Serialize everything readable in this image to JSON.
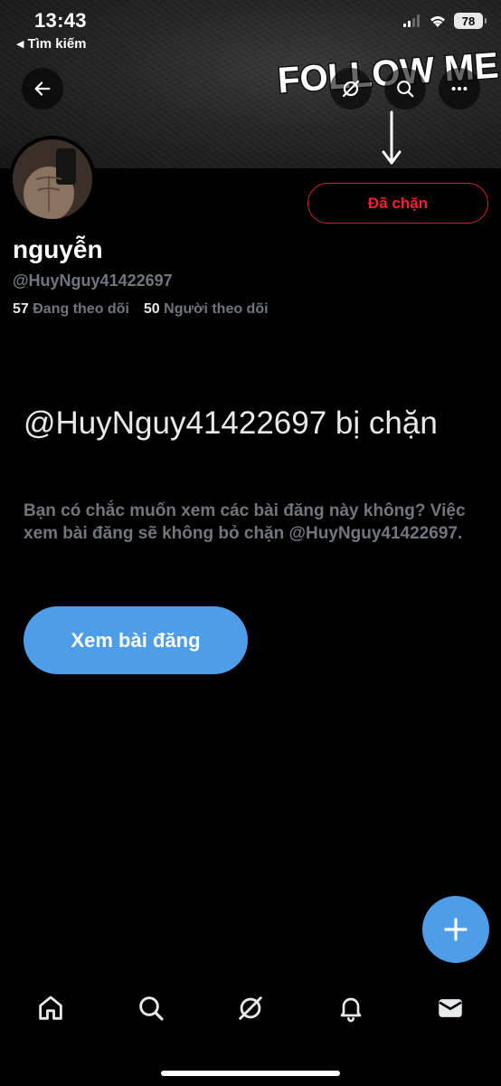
{
  "status_bar": {
    "time": "13:43",
    "back_app": "Tìm kiếm",
    "battery": "78"
  },
  "banner": {
    "text": "FOLLOW ME"
  },
  "header": {
    "back_icon": "arrow-left-icon",
    "grok_icon": "grok-icon",
    "search_icon": "search-icon",
    "more_icon": "more-horizontal-icon"
  },
  "profile": {
    "blocked_label": "Đã chặn",
    "display_name": "nguyễn",
    "handle": "@HuyNguy41422697",
    "following_count": "57",
    "following_label": "Đang theo dõi",
    "followers_count": "50",
    "followers_label": "Người theo dõi"
  },
  "blocked_notice": {
    "title": "@HuyNguy41422697 bị chặn",
    "description": "Bạn có chắc muốn xem các bài đăng này không? Việc xem bài đăng sẽ không bỏ chặn @HuyNguy41422697.",
    "button_label": "Xem bài đăng"
  },
  "bottom_nav": {
    "items": [
      "home-icon",
      "search-icon",
      "grok-icon",
      "bell-icon",
      "mail-icon"
    ]
  },
  "colors": {
    "accent": "#4d9de9",
    "blocked_red": "#f4212e",
    "secondary_text": "#71767b"
  }
}
